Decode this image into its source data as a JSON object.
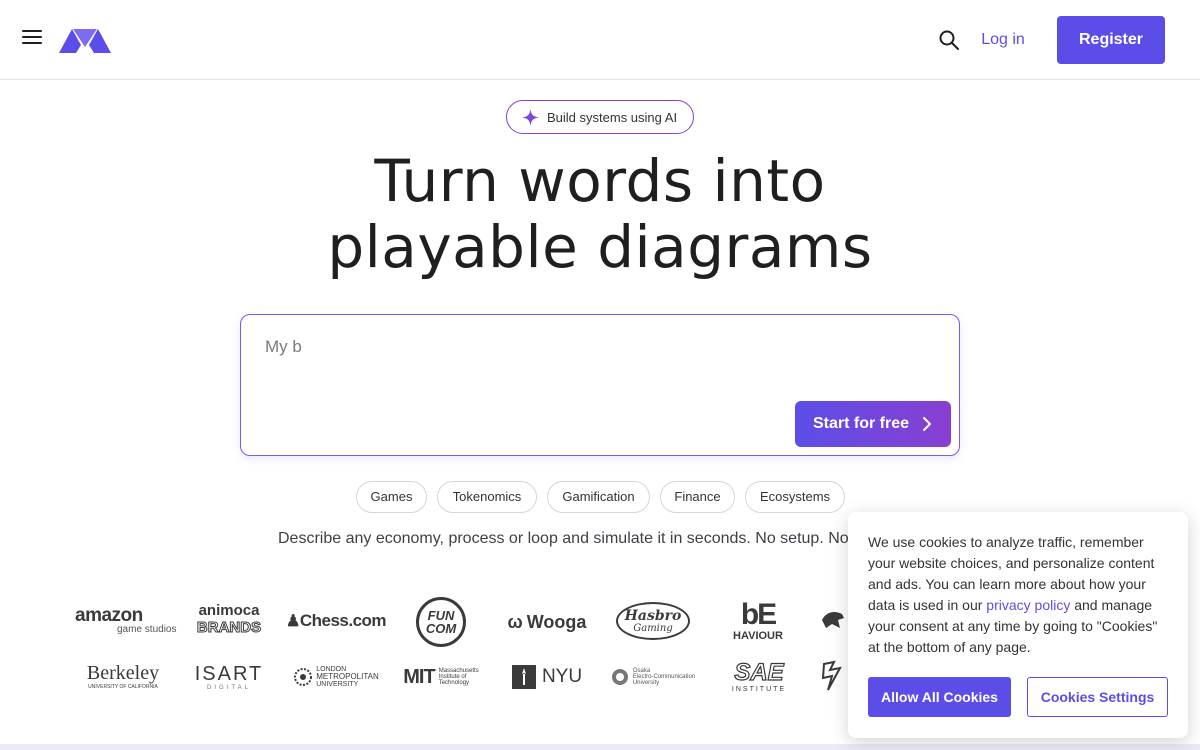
{
  "header": {
    "menu_icon": "hamburger-menu-icon",
    "logo_icon": "machinations-logo",
    "search_icon": "search-icon",
    "login_label": "Log in",
    "register_label": "Register",
    "accent_color": "#5b4ee8"
  },
  "hero": {
    "badge_icon": "sparkle-icon",
    "badge_text": "Build systems using AI",
    "headline_line1": "Turn words into",
    "headline_line2": "playable diagrams",
    "prompt_value": "My b",
    "start_label": "Start for free",
    "start_icon": "chevron-right-icon"
  },
  "chips": [
    "Games",
    "Tokenomics",
    "Gamification",
    "Finance",
    "Ecosystems"
  ],
  "tagline": "Describe any economy, process or loop and simulate it in seconds. No setup. No c",
  "logos": {
    "amazon_1": "amazon",
    "amazon_2": "game studios",
    "animoca_1": "animoca",
    "animoca_2": "BRANDS",
    "chess": "Chess.com",
    "funcom_1": "FUN",
    "funcom_2": "COM",
    "wooga": "Wooga",
    "hasbro_1": "Hasbro",
    "hasbro_2": "Gaming",
    "behaviour_1": "bE",
    "behaviour_2": "HAVIOUR",
    "berkeley_1": "Berkeley",
    "berkeley_2": "UNIVERSITY OF CALIFORNIA",
    "isart_1": "ISART",
    "isart_2": "DIGITAL",
    "london_1": "LONDON",
    "london_2": "METROPOLITAN",
    "london_3": "UNIVERSITY",
    "mit_1": "Massachusetts",
    "mit_2": "Institute of",
    "mit_3": "Technology",
    "nyu": "NYU",
    "osaka_1": "Osaka",
    "osaka_2": "Electro-Communication",
    "osaka_3": "University",
    "sae_1": "SAE",
    "sae_2": "INSTITUTE"
  },
  "cookie": {
    "text_before_link": "We use cookies to analyze traffic, remember your website choices, and personalize content and ads. You can learn more about how your data is used in our ",
    "link_text": "privacy policy",
    "text_after_link": " and manage your consent at any time by going to \"Cookies\" at the bottom of any page.",
    "allow_label": "Allow All Cookies",
    "settings_label": "Cookies Settings"
  }
}
